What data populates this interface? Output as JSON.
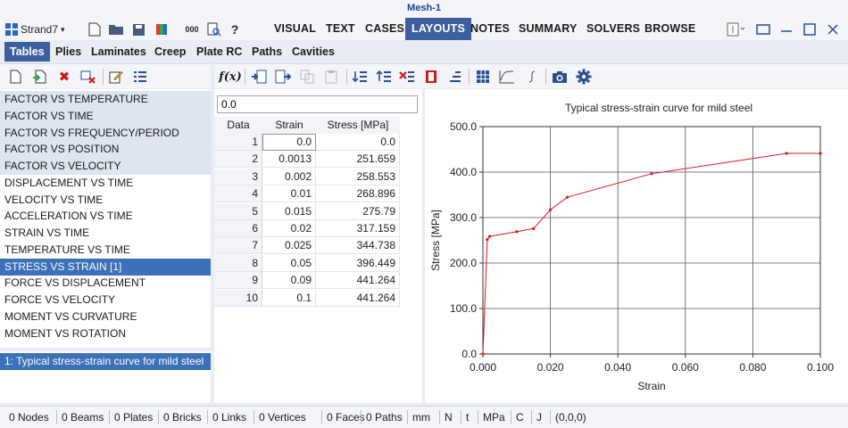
{
  "window": {
    "title": "Mesh-1"
  },
  "app": {
    "name": "Strand7"
  },
  "menu": [
    "VISUAL",
    "TEXT",
    "CASES",
    "LAYOUTS",
    "NOTES",
    "SUMMARY",
    "SOLVERS",
    "BROWSE"
  ],
  "menu_active": "LAYOUTS",
  "quick_toolbar": {
    "help_label": "?"
  },
  "tabs": [
    "Tables",
    "Plies",
    "Laminates",
    "Creep",
    "Plate RC",
    "Paths",
    "Cavities"
  ],
  "tabs_active": "Tables",
  "table_types": [
    "FACTOR VS TEMPERATURE",
    "FACTOR VS TIME",
    "FACTOR VS FREQUENCY/PERIOD",
    "FACTOR VS POSITION",
    "FACTOR VS VELOCITY",
    "DISPLACEMENT VS TIME",
    "VELOCITY VS TIME",
    "ACCELERATION VS TIME",
    "STRAIN VS TIME",
    "TEMPERATURE VS TIME",
    "STRESS VS STRAIN   [1]",
    "FORCE VS DISPLACEMENT",
    "FORCE VS VELOCITY",
    "MOMENT VS CURVATURE",
    "MOMENT VS ROTATION"
  ],
  "table_instances": [
    "1: Typical stress-strain curve for mild steel"
  ],
  "fx_toolbar": {
    "fx_label": "f(x)"
  },
  "formula_value": "0.0",
  "data_table": {
    "headers": [
      "Data",
      "Strain",
      "Stress [MPa]"
    ],
    "rows": [
      [
        "1",
        "0.0",
        "0.0"
      ],
      [
        "2",
        "0.0013",
        "251.659"
      ],
      [
        "3",
        "0.002",
        "258.553"
      ],
      [
        "4",
        "0.01",
        "268.896"
      ],
      [
        "5",
        "0.015",
        "275.79"
      ],
      [
        "6",
        "0.02",
        "317.159"
      ],
      [
        "7",
        "0.025",
        "344.738"
      ],
      [
        "8",
        "0.05",
        "396.449"
      ],
      [
        "9",
        "0.09",
        "441.264"
      ],
      [
        "10",
        "0.1",
        "441.264"
      ]
    ]
  },
  "chart_data": {
    "type": "line",
    "title": "Typical stress-strain curve for mild steel",
    "xlabel": "Strain",
    "ylabel": "Stress [MPa]",
    "xlim": [
      0,
      0.1
    ],
    "ylim": [
      0,
      500
    ],
    "x_ticks": [
      "0.000",
      "0.020",
      "0.040",
      "0.060",
      "0.080",
      "0.100"
    ],
    "y_ticks": [
      "0.0",
      "100.0",
      "200.0",
      "300.0",
      "400.0",
      "500.0"
    ],
    "grid": true,
    "series": [
      {
        "color": "#e0141e",
        "x": [
          0.0,
          0.0013,
          0.002,
          0.01,
          0.015,
          0.02,
          0.025,
          0.05,
          0.09,
          0.1
        ],
        "y": [
          0.0,
          251.659,
          258.553,
          268.896,
          275.79,
          317.159,
          344.738,
          396.449,
          441.264,
          441.264
        ]
      }
    ]
  },
  "status_bar": [
    "0 Nodes",
    "0 Beams",
    "0 Plates",
    "0 Bricks",
    "0 Links",
    "0 Vertices",
    "0 Faces",
    "0 Paths",
    "mm",
    "N",
    "t",
    "MPa",
    "C",
    "J",
    "(0,0,0)"
  ],
  "colors": {
    "accent": "#3c5f9e",
    "selection": "#3c70b8",
    "curve": "#e0141e"
  }
}
